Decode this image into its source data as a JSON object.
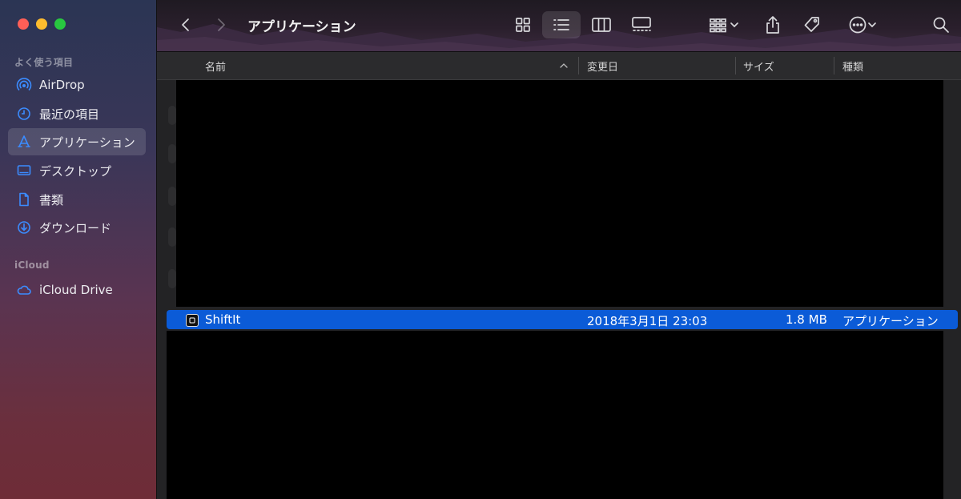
{
  "window": {
    "title": "アプリケーション"
  },
  "sidebar": {
    "sections": [
      {
        "label": "よく使う項目",
        "items": [
          {
            "label": "AirDrop",
            "icon": "airdrop-icon"
          },
          {
            "label": "最近の項目",
            "icon": "clock-icon"
          },
          {
            "label": "アプリケーション",
            "icon": "applications-icon",
            "selected": true
          },
          {
            "label": "デスクトップ",
            "icon": "desktop-icon"
          },
          {
            "label": "書類",
            "icon": "document-icon"
          },
          {
            "label": "ダウンロード",
            "icon": "download-icon"
          }
        ]
      },
      {
        "label": "iCloud",
        "items": [
          {
            "label": "iCloud Drive",
            "icon": "cloud-icon"
          }
        ]
      }
    ]
  },
  "toolbar": {
    "view_modes": [
      "icon-view",
      "list-view",
      "column-view",
      "gallery-view"
    ],
    "active_view": "list-view"
  },
  "columns": {
    "name": "名前",
    "date_modified": "変更日",
    "size": "サイズ",
    "kind": "種類"
  },
  "files": [
    {
      "name": "ShiftIt",
      "date_modified": "2018年3月1日 23:03",
      "size": "1.8 MB",
      "kind": "アプリケーション",
      "selected": true
    }
  ],
  "colors": {
    "accent": "#0b5bd7",
    "sidebar_top": "#2b3554",
    "sidebar_bottom": "#6e2c37"
  }
}
